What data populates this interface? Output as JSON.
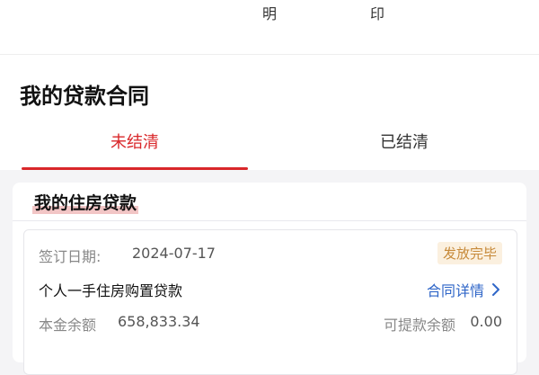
{
  "top": {
    "label_1": "明",
    "label_2": "印"
  },
  "page": {
    "title": "我的贷款合同"
  },
  "tabs": [
    {
      "label": "未结清",
      "active": true
    },
    {
      "label": "已结清",
      "active": false
    }
  ],
  "card": {
    "title": "我的住房贷款",
    "loan": {
      "sign_date_label": "签订日期:",
      "sign_date": "2024-07-17",
      "status": "发放完毕",
      "product": "个人一手住房购置贷款",
      "detail_link": "合同详情",
      "balance_label": "本金余额",
      "balance": "658,833.34",
      "withdrawable_label": "可提款余额",
      "withdrawable": "0.00"
    }
  },
  "colors": {
    "accent_red": "#d9272a",
    "link_blue": "#2f66c8",
    "badge_bg": "#fbf0df",
    "badge_text": "#c78a3a"
  },
  "icons": {
    "detail_link": "chevron-right-icon"
  }
}
